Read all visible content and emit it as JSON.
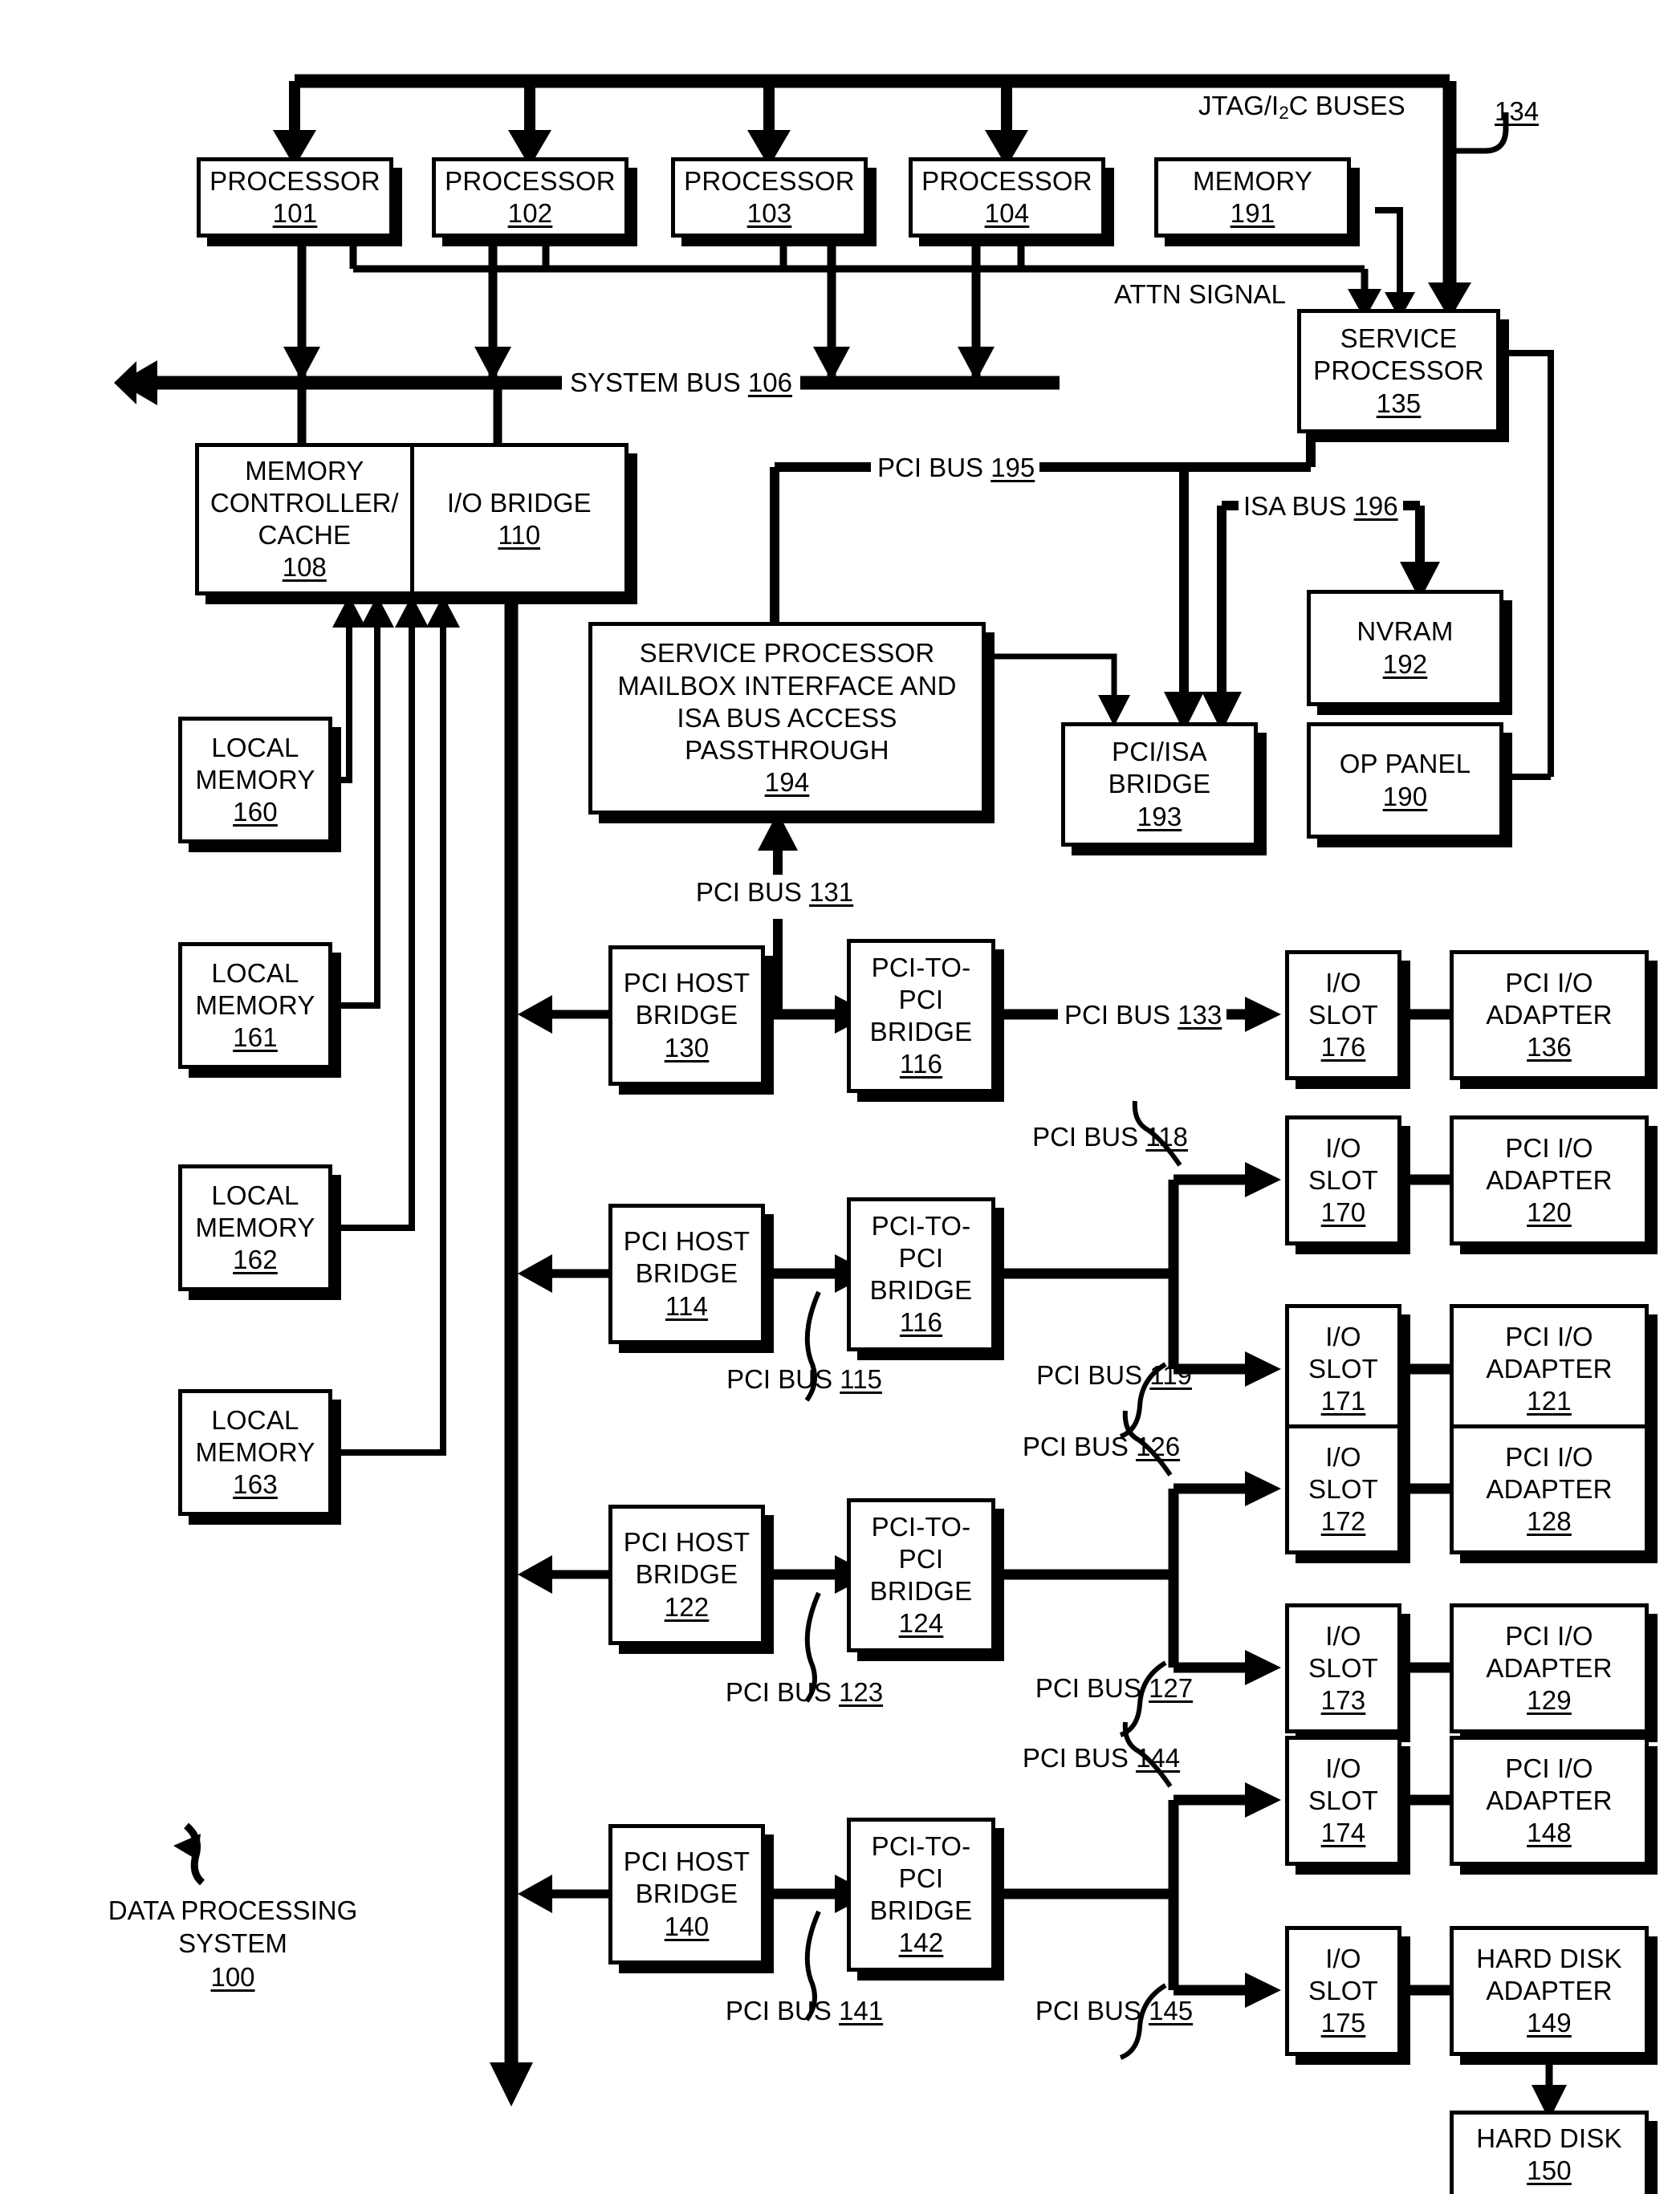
{
  "figure": {
    "caption": "DATA PROCESSING SYSTEM",
    "caption_ref": "100"
  },
  "labels": {
    "jtag_buses": "JTAG/I",
    "jtag_buses_sub": "2",
    "jtag_buses_tail": "C BUSES",
    "jtag_ref": "134",
    "attn_signal": "ATTN SIGNAL",
    "system_bus": "SYSTEM BUS ",
    "system_bus_ref": "106",
    "pci_bus_195": "PCI BUS ",
    "pci_bus_195_ref": "195",
    "isa_bus_196": "ISA BUS ",
    "isa_bus_196_ref": "196",
    "pci_bus_131": "PCI BUS ",
    "pci_bus_131_ref": "131",
    "pci_bus_133": "PCI BUS ",
    "pci_bus_133_ref": "133",
    "pci_bus_115": "PCI BUS ",
    "pci_bus_115_ref": "115",
    "pci_bus_118": "PCI BUS ",
    "pci_bus_118_ref": "118",
    "pci_bus_119": "PCI BUS ",
    "pci_bus_119_ref": "119",
    "pci_bus_123": "PCI BUS ",
    "pci_bus_123_ref": "123",
    "pci_bus_126": "PCI BUS ",
    "pci_bus_126_ref": "126",
    "pci_bus_127": "PCI BUS ",
    "pci_bus_127_ref": "127",
    "pci_bus_141": "PCI BUS ",
    "pci_bus_141_ref": "141",
    "pci_bus_144": "PCI BUS ",
    "pci_bus_144_ref": "144",
    "pci_bus_145": "PCI BUS ",
    "pci_bus_145_ref": "145"
  },
  "blocks": {
    "processor_101": {
      "title": "PROCESSOR",
      "ref": "101"
    },
    "processor_102": {
      "title": "PROCESSOR",
      "ref": "102"
    },
    "processor_103": {
      "title": "PROCESSOR",
      "ref": "103"
    },
    "processor_104": {
      "title": "PROCESSOR",
      "ref": "104"
    },
    "memory_191": {
      "title": "MEMORY",
      "ref": "191"
    },
    "service_processor_135": {
      "title": "SERVICE\nPROCESSOR",
      "ref": "135"
    },
    "memory_controller_108": {
      "title": "MEMORY\nCONTROLLER/\nCACHE",
      "ref": "108"
    },
    "io_bridge_110": {
      "title": "I/O\nBRIDGE",
      "ref": "110"
    },
    "sp_mailbox_194": {
      "title": "SERVICE PROCESSOR\nMAILBOX INTERFACE AND\nISA BUS ACCESS\nPASSTHROUGH",
      "ref": "194"
    },
    "pci_isa_bridge_193": {
      "title": "PCI/ISA\nBRIDGE",
      "ref": "193"
    },
    "nvram_192": {
      "title": "NVRAM",
      "ref": "192"
    },
    "op_panel_190": {
      "title": "OP PANEL",
      "ref": "190"
    },
    "local_memory_160": {
      "title": "LOCAL\nMEMORY",
      "ref": "160"
    },
    "local_memory_161": {
      "title": "LOCAL\nMEMORY",
      "ref": "161"
    },
    "local_memory_162": {
      "title": "LOCAL\nMEMORY",
      "ref": "162"
    },
    "local_memory_163": {
      "title": "LOCAL\nMEMORY",
      "ref": "163"
    },
    "pci_host_bridge_130": {
      "title": "PCI HOST\nBRIDGE",
      "ref": "130"
    },
    "pci_host_bridge_114": {
      "title": "PCI HOST\nBRIDGE",
      "ref": "114"
    },
    "pci_host_bridge_122": {
      "title": "PCI HOST\nBRIDGE",
      "ref": "122"
    },
    "pci_host_bridge_140": {
      "title": "PCI HOST\nBRIDGE",
      "ref": "140"
    },
    "pci_to_pci_116a": {
      "title": "PCI-TO-\nPCI\nBRIDGE",
      "ref": "116"
    },
    "pci_to_pci_116b": {
      "title": "PCI-TO-\nPCI\nBRIDGE",
      "ref": "116"
    },
    "pci_to_pci_124": {
      "title": "PCI-TO-\nPCI\nBRIDGE",
      "ref": "124"
    },
    "pci_to_pci_142": {
      "title": "PCI-TO-\nPCI\nBRIDGE",
      "ref": "142"
    },
    "io_slot_176": {
      "title": "I/O\nSLOT",
      "ref": "176"
    },
    "io_slot_170": {
      "title": "I/O\nSLOT",
      "ref": "170"
    },
    "io_slot_171": {
      "title": "I/O\nSLOT",
      "ref": "171"
    },
    "io_slot_172": {
      "title": "I/O\nSLOT",
      "ref": "172"
    },
    "io_slot_173": {
      "title": "I/O\nSLOT",
      "ref": "173"
    },
    "io_slot_174": {
      "title": "I/O\nSLOT",
      "ref": "174"
    },
    "io_slot_175": {
      "title": "I/O\nSLOT",
      "ref": "175"
    },
    "pci_io_adapter_136": {
      "title": "PCI I/O\nADAPTER",
      "ref": "136"
    },
    "pci_io_adapter_120": {
      "title": "PCI I/O\nADAPTER",
      "ref": "120"
    },
    "pci_io_adapter_121": {
      "title": "PCI I/O\nADAPTER",
      "ref": "121"
    },
    "pci_io_adapter_128": {
      "title": "PCI I/O\nADAPTER",
      "ref": "128"
    },
    "pci_io_adapter_129": {
      "title": "PCI I/O\nADAPTER",
      "ref": "129"
    },
    "pci_io_adapter_148": {
      "title": "PCI I/O\nADAPTER",
      "ref": "148"
    },
    "hard_disk_adapter_149": {
      "title": "HARD DISK\nADAPTER",
      "ref": "149"
    },
    "hard_disk_150": {
      "title": "HARD DISK",
      "ref": "150"
    }
  }
}
